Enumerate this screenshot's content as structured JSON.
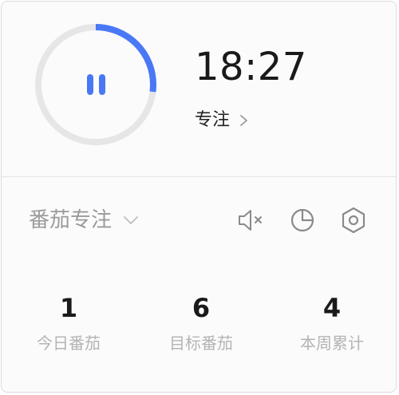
{
  "timer": {
    "time": "18:27",
    "progress": 0.27,
    "state": "running",
    "icon": "pause-icon",
    "accent_color": "#4a78f5",
    "track_color": "#e6e6e6"
  },
  "mode": {
    "label": "专注"
  },
  "type_select": {
    "value": "番茄专注"
  },
  "tools": [
    {
      "name": "mute-icon"
    },
    {
      "name": "statistics-icon"
    },
    {
      "name": "settings-icon"
    }
  ],
  "stats": [
    {
      "value": "1",
      "label": "今日番茄"
    },
    {
      "value": "6",
      "label": "目标番茄"
    },
    {
      "value": "4",
      "label": "本周累计"
    }
  ]
}
